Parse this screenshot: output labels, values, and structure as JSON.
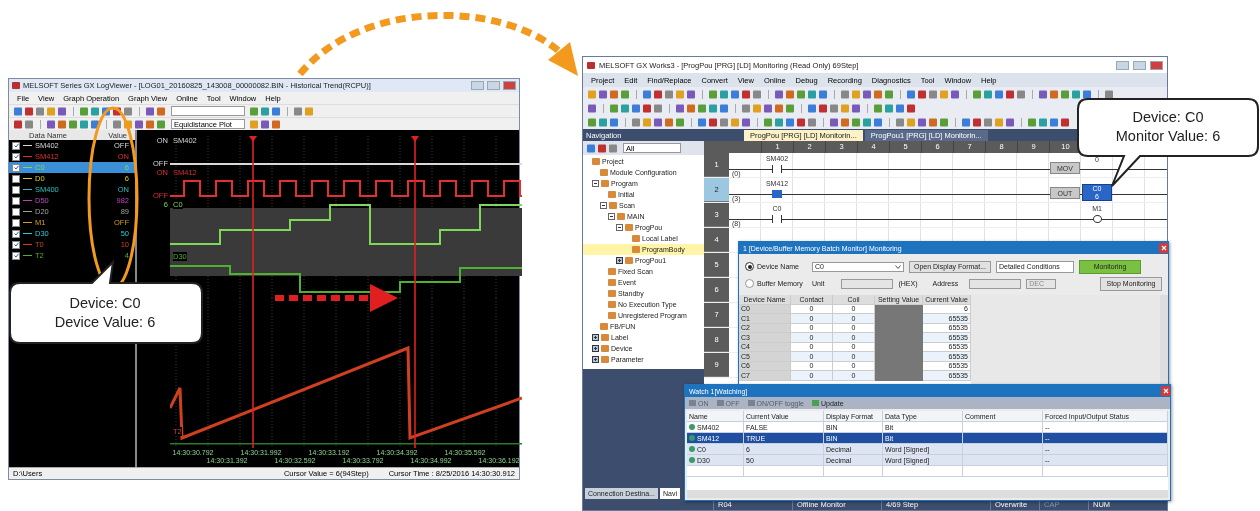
{
  "log_viewer": {
    "title": "MELSOFT Series GX LogViewer - [LOG01_20160825_143008_00000082.BIN - Historical Trend(RCPU)]",
    "menu": [
      "File",
      "View",
      "Graph Operation",
      "Graph View",
      "Online",
      "Tool",
      "Window",
      "Help"
    ],
    "plot_mode": "Equidistance Plot",
    "legend": {
      "columns": [
        "Data Name",
        "Value"
      ],
      "rows": [
        {
          "name": "SM402",
          "value": "OFF",
          "color": "#d8d8d8",
          "checked": true,
          "selected": false
        },
        {
          "name": "SM412",
          "value": "ON",
          "color": "#e03030",
          "checked": true,
          "selected": false
        },
        {
          "name": "C0",
          "value": "6",
          "color": "#7ed957",
          "checked": true,
          "selected": true
        },
        {
          "name": "D0",
          "value": "6",
          "color": "#d8d020",
          "checked": false,
          "selected": false
        },
        {
          "name": "SM400",
          "value": "ON",
          "color": "#30c0c0",
          "checked": false,
          "selected": false
        },
        {
          "name": "D50",
          "value": "982",
          "color": "#c040c0",
          "checked": false,
          "selected": false
        },
        {
          "name": "D20",
          "value": "89",
          "color": "#a0a0a0",
          "checked": false,
          "selected": false
        },
        {
          "name": "M1",
          "value": "OFF",
          "color": "#d0a020",
          "checked": false,
          "selected": false
        },
        {
          "name": "D30",
          "value": "50",
          "color": "#30c8d8",
          "checked": true,
          "selected": false
        },
        {
          "name": "T0",
          "value": "10",
          "color": "#d04020",
          "checked": true,
          "selected": false
        },
        {
          "name": "T2",
          "value": "4",
          "color": "#50b030",
          "checked": true,
          "selected": false
        }
      ]
    },
    "bands": [
      {
        "kind": "flat_bit",
        "high": "ON",
        "low": "OFF",
        "name": "SM402",
        "color": "#d8d8d8"
      },
      {
        "kind": "pulse_bit",
        "high": "ON",
        "low": "OFF",
        "name": "SM412",
        "color": "#e03030"
      },
      {
        "kind": "steps",
        "high": "6",
        "name": "C0",
        "color": "#7ed957"
      },
      {
        "kind": "steps_low",
        "name": "D30",
        "color": "#50b030"
      },
      {
        "kind": "ramp",
        "name": "T2",
        "color": "#d04020"
      }
    ],
    "time_labels": [
      "14:30:30.792",
      "14:30:31.392",
      "14:30:31.992",
      "14:30:32.592",
      "14:30:33.192",
      "14:30:33.792",
      "14:30:34.392",
      "14:30:34.992",
      "14:30:35.592",
      "14:30:36.192"
    ],
    "status_bar": {
      "path": "D:\\Users",
      "cursor_value": "Cursor Value = 6(94Step)",
      "cursor_time": "Cursor Time : 8/25/2016 14:30:30.912"
    }
  },
  "gx_works": {
    "title": "MELSOFT GX Works3 - [ProgPou [PRG] [LD] Monitoring (Read Only) 69Step]",
    "menu": [
      "Project",
      "Edit",
      "Find/Replace",
      "Convert",
      "View",
      "Online",
      "Debug",
      "Recording",
      "Diagnostics",
      "Tool",
      "Window",
      "Help"
    ],
    "navigation": {
      "title": "Navigation",
      "filter": "All",
      "tree": [
        {
          "label": "Project",
          "selected": false,
          "children": [
            {
              "label": "Module Configuration",
              "selected": false
            },
            {
              "label": "Program",
              "selected": false,
              "expanded": true,
              "children": [
                {
                  "label": "Initial",
                  "selected": false
                },
                {
                  "label": "Scan",
                  "selected": false,
                  "expanded": true,
                  "children": [
                    {
                      "label": "MAIN",
                      "selected": false,
                      "expanded": true,
                      "children": [
                        {
                          "label": "ProgPou",
                          "selected": false,
                          "expanded": true,
                          "children": [
                            {
                              "label": "Local Label",
                              "selected": false
                            },
                            {
                              "label": "ProgramBody",
                              "selected": true
                            }
                          ]
                        },
                        {
                          "label": "ProgPou1",
                          "selected": false,
                          "expanded": false
                        }
                      ]
                    }
                  ]
                },
                {
                  "label": "Fixed Scan",
                  "selected": false
                },
                {
                  "label": "Event",
                  "selected": false
                },
                {
                  "label": "Standby",
                  "selected": false
                },
                {
                  "label": "No Execution Type",
                  "selected": false
                },
                {
                  "label": "Unregistered Program",
                  "selected": false
                }
              ]
            },
            {
              "label": "FB/FUN",
              "selected": false
            },
            {
              "label": "Label",
              "selected": false,
              "expanded": false
            },
            {
              "label": "Device",
              "selected": false,
              "expanded": false
            },
            {
              "label": "Parameter",
              "selected": false,
              "expanded": false
            }
          ]
        }
      ]
    },
    "bottom_tabs": [
      {
        "label": "Connection Destina...",
        "selected": false
      },
      {
        "label": "Navi",
        "selected": true
      }
    ],
    "editor_tabs": [
      {
        "label": "ProgPou [PRG] [LD] Monitorin...",
        "selected": true
      },
      {
        "label": "ProgPou1 [PRG] [LD] Monitorin...",
        "selected": false
      }
    ],
    "ladder": {
      "columns": [
        "1",
        "2",
        "3",
        "4",
        "5",
        "6",
        "7",
        "8",
        "9",
        "10"
      ],
      "rows": [
        {
          "number": "1",
          "step": "(0)",
          "selected": false,
          "left": [
            {
              "kind": "contact",
              "device": "SM402",
              "on": false
            }
          ],
          "right": [
            {
              "kind": "instruction",
              "label": "MOV"
            },
            {
              "kind": "operand",
              "label": "0"
            }
          ]
        },
        {
          "number": "2",
          "step": "(3)",
          "selected": true,
          "left": [
            {
              "kind": "contact",
              "device": "SM412",
              "on": true
            }
          ],
          "right": [
            {
              "kind": "instruction",
              "label": "OUT"
            },
            {
              "kind": "monitor",
              "device": "C0",
              "value": "6"
            }
          ]
        },
        {
          "number": "3",
          "step": "(8)",
          "selected": false,
          "left": [
            {
              "kind": "contact",
              "device": "C0",
              "on": false
            }
          ],
          "right": [
            {
              "kind": "coil",
              "device": "M1"
            }
          ]
        },
        {
          "number": "4",
          "selected": false
        },
        {
          "number": "5",
          "selected": false
        },
        {
          "number": "6",
          "selected": false
        },
        {
          "number": "7",
          "selected": false
        },
        {
          "number": "8",
          "selected": false
        },
        {
          "number": "9",
          "selected": false
        }
      ]
    },
    "batch_monitor": {
      "title": "1 [Device/Buffer Memory Batch Monitor] Monitoring",
      "modes": [
        {
          "label": "Device Name",
          "selected": true
        },
        {
          "label": "Buffer Memory",
          "selected": false
        }
      ],
      "device": "C0",
      "open_format": "Open Display Format...",
      "conditions": "Detailed Conditions",
      "monitor_button": "Monitoring",
      "stop_button": "Stop Monitoring",
      "unit_label": "Unit",
      "hex": "(HEX)",
      "address_label": "Address",
      "radix": "DEC",
      "columns": [
        "Device Name",
        "Contact",
        "Coil",
        "Setting Value",
        "Current Value"
      ],
      "rows": [
        {
          "device": "C0",
          "contact": "0",
          "coil": "0",
          "current": "6"
        },
        {
          "device": "C1",
          "contact": "0",
          "coil": "0",
          "current": "65535"
        },
        {
          "device": "C2",
          "contact": "0",
          "coil": "0",
          "current": "65535"
        },
        {
          "device": "C3",
          "contact": "0",
          "coil": "0",
          "current": "65535"
        },
        {
          "device": "C4",
          "contact": "0",
          "coil": "0",
          "current": "65535"
        },
        {
          "device": "C5",
          "contact": "0",
          "coil": "0",
          "current": "65535"
        },
        {
          "device": "C6",
          "contact": "0",
          "coil": "0",
          "current": "65535"
        },
        {
          "device": "C7",
          "contact": "0",
          "coil": "0",
          "current": "65535"
        }
      ]
    },
    "watch": {
      "title": "Watch 1[Watching]",
      "tools": [
        {
          "label": "ON",
          "disabled": true
        },
        {
          "label": "OFF",
          "disabled": true
        },
        {
          "label": "ON/OFF toggle",
          "disabled": true
        },
        {
          "label": "Update",
          "disabled": false
        }
      ],
      "columns": [
        "Name",
        "Current Value",
        "Display Format",
        "Data Type",
        "Comment",
        "Forced Input/Output Status"
      ],
      "rows": [
        {
          "name": "SM402",
          "value": "FALSE",
          "format": "BIN",
          "type": "Bit",
          "forced": "--",
          "selected": false
        },
        {
          "name": "SM412",
          "value": "TRUE",
          "format": "BIN",
          "type": "Bit",
          "forced": "--",
          "selected": true
        },
        {
          "name": "C0",
          "value": "6",
          "format": "Decimal",
          "type": "Word [Signed]",
          "forced": "--",
          "selected": false
        },
        {
          "name": "D30",
          "value": "50",
          "format": "Decimal",
          "type": "Word [Signed]",
          "forced": "--",
          "selected": false
        }
      ]
    },
    "status_bar": [
      {
        "text": "R04",
        "disabled": false
      },
      {
        "text": "Offline Monitor",
        "disabled": false
      },
      {
        "text": "4/69 Step",
        "disabled": false
      },
      {
        "text": "Overwrite",
        "disabled": false
      },
      {
        "text": "CAP",
        "disabled": true
      },
      {
        "text": "NUM",
        "disabled": false
      }
    ]
  },
  "callouts": [
    {
      "lines": [
        "Device: C0",
        "Device Value: 6"
      ]
    },
    {
      "lines": [
        "Device: C0",
        "Monitor Value: 6"
      ]
    }
  ]
}
